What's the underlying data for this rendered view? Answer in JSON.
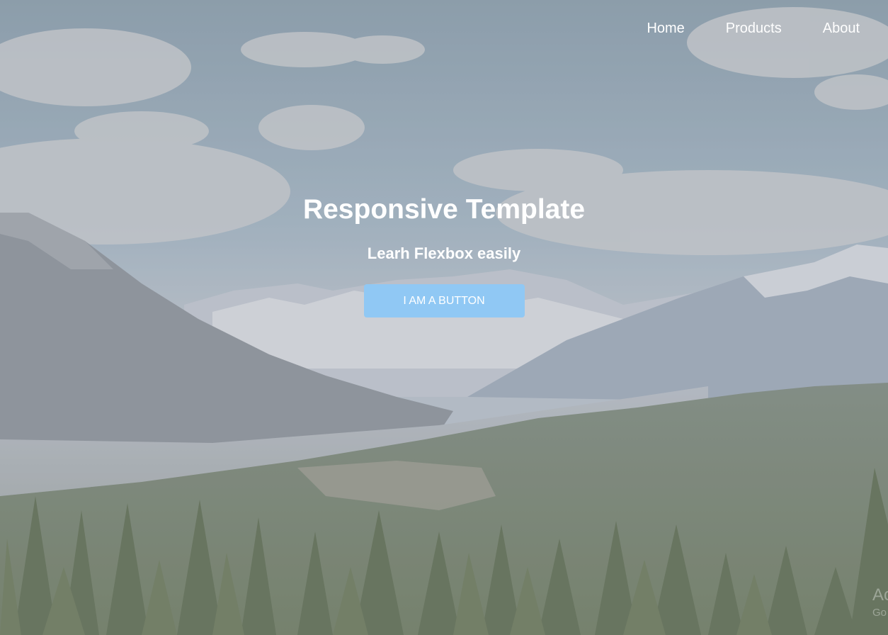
{
  "nav": {
    "items": [
      {
        "label": "Home"
      },
      {
        "label": "Products"
      },
      {
        "label": "About"
      }
    ]
  },
  "hero": {
    "title": "Responsive Template",
    "subtitle": "Learh Flexbox easily",
    "button_label": "I AM A BUTTON"
  },
  "watermark": {
    "line1": "Ac",
    "line2": "Go"
  },
  "colors": {
    "button": "#90c8f4",
    "text": "#ffffff"
  }
}
